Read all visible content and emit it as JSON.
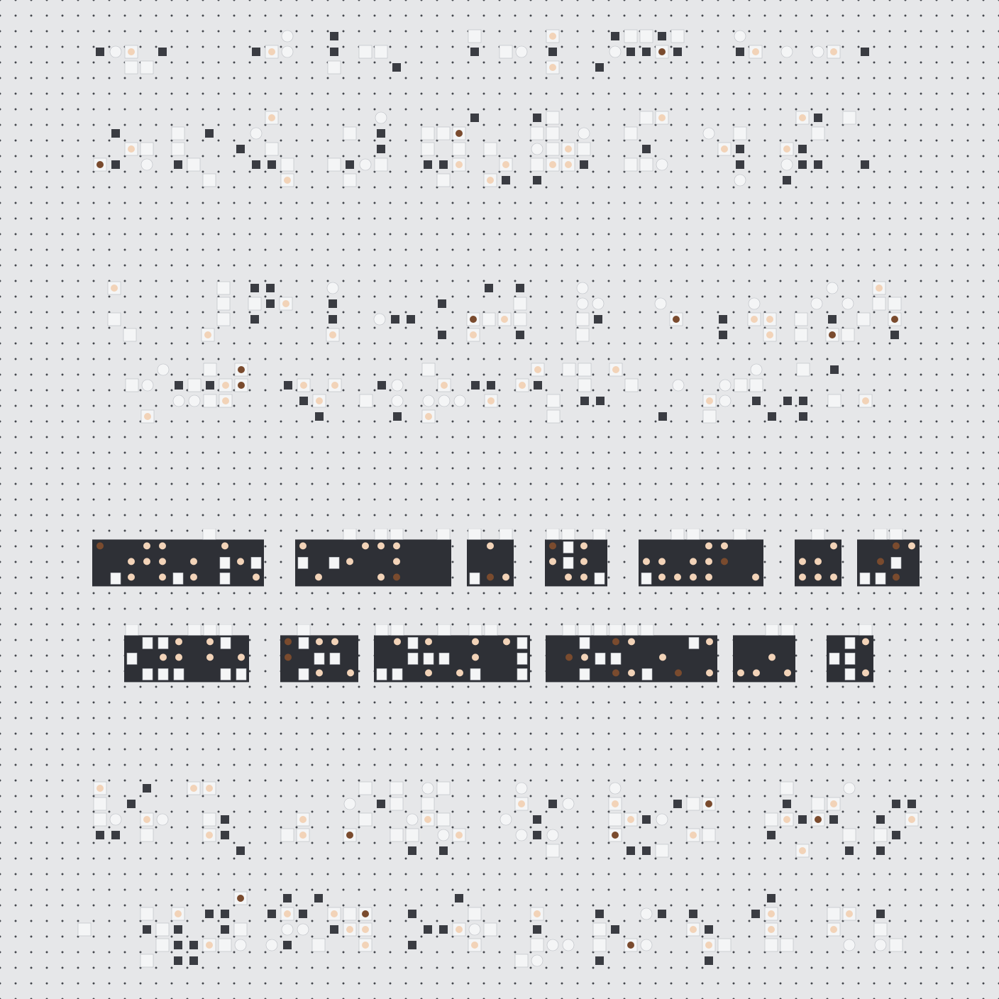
{
  "page": {
    "background": "#e6e7e9",
    "dot_color": "#44474d",
    "tile_dark": "#3a3c42",
    "tile_light": "#f4f5f6",
    "panel_dark": "#2e3036"
  },
  "groups": [
    {
      "style": "light-tiles",
      "lines": [
        {
          "tiles": "mixed-emoji-row"
        },
        {
          "tiles": "mixed-emoji-row"
        }
      ]
    },
    {
      "style": "light-tiles",
      "lines": [
        {
          "tiles": "mixed-emoji-row"
        },
        {
          "tiles": "mixed-emoji-row"
        }
      ]
    },
    {
      "style": "dark-panels",
      "lines": [
        {
          "tiles": "dense-emoji-row"
        },
        {
          "tiles": "dense-emoji-row"
        }
      ]
    },
    {
      "style": "light-tiles",
      "lines": [
        {
          "tiles": "mixed-emoji-row"
        },
        {
          "tiles": "mixed-emoji-row"
        }
      ]
    }
  ]
}
